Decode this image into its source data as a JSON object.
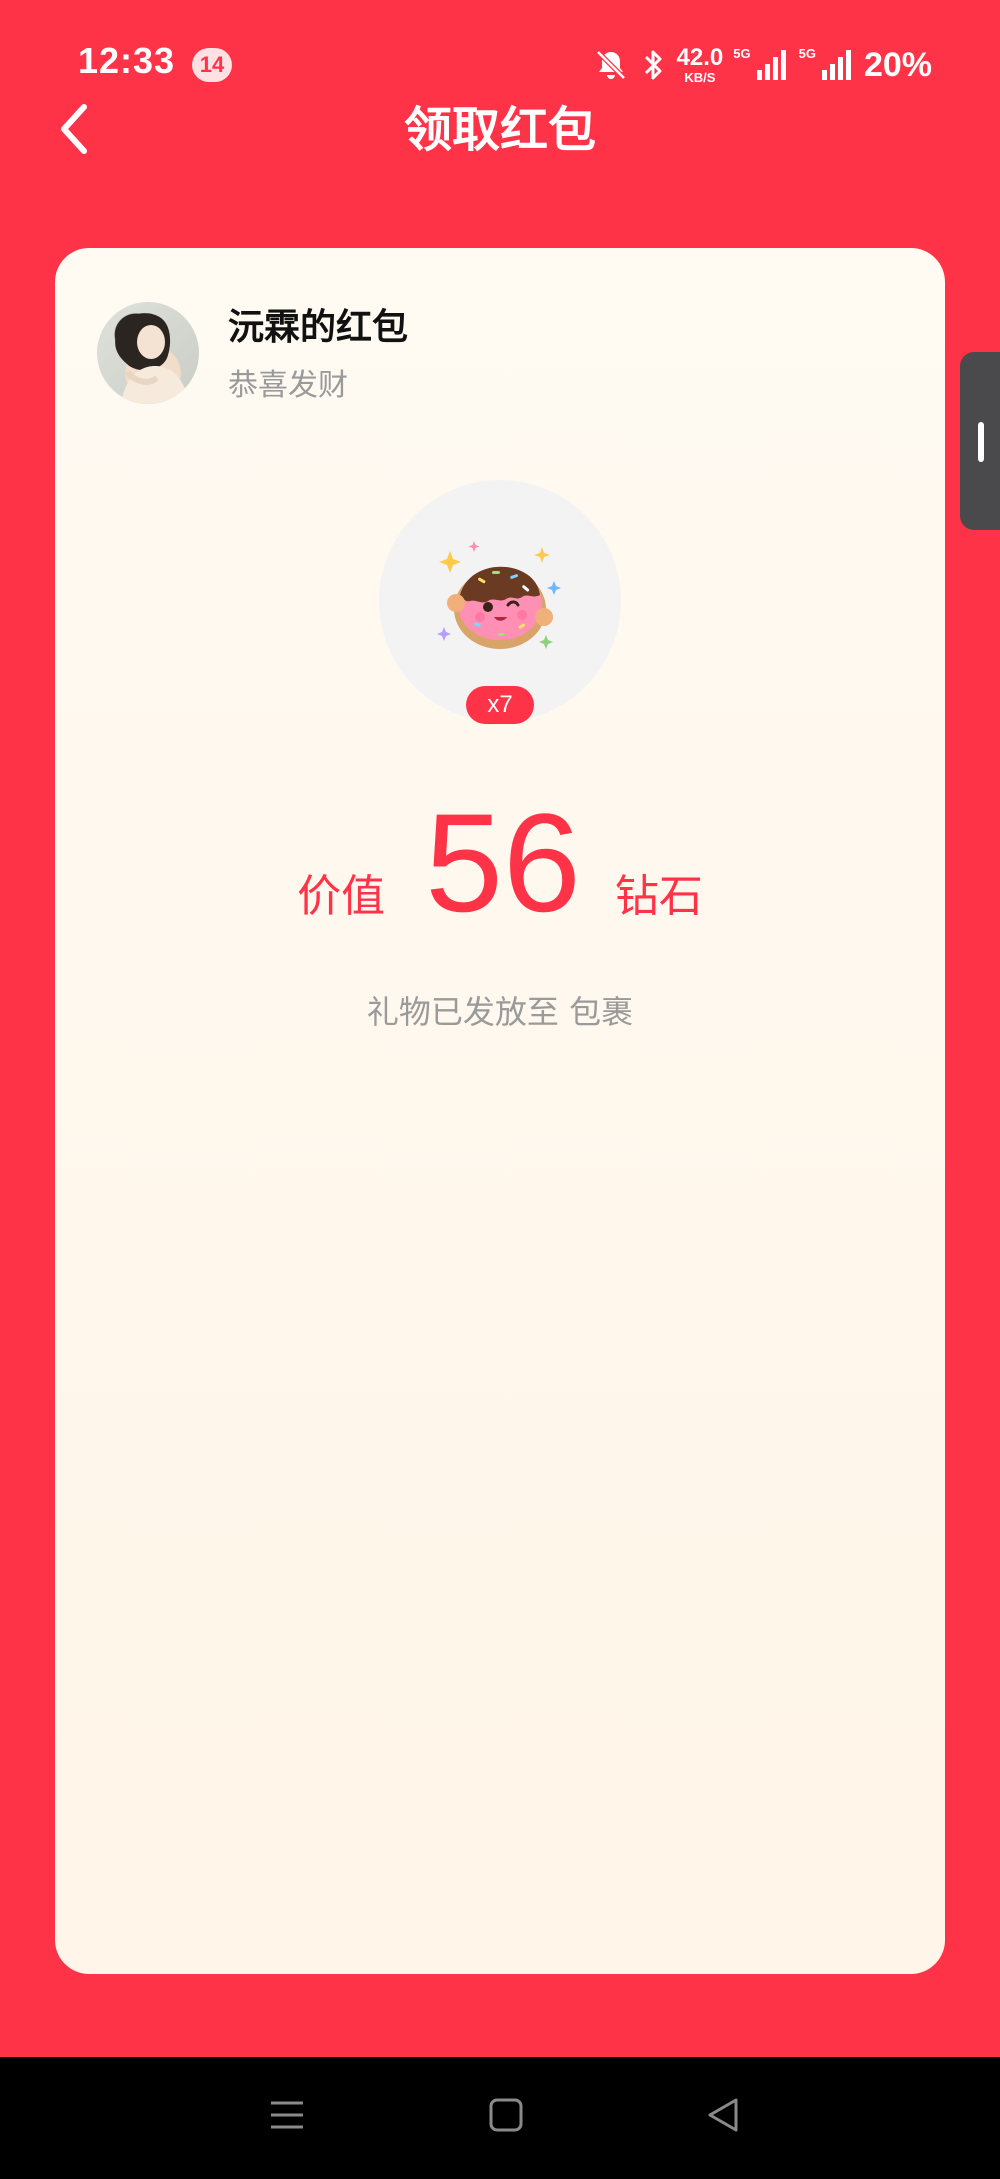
{
  "status_bar": {
    "time": "12:33",
    "notification_count": "14",
    "net_speed_value": "42.0",
    "net_speed_unit": "KB/S",
    "signal_label_1": "5G",
    "signal_label_2": "5G",
    "battery": "20%",
    "icons": [
      "mute-bell-icon",
      "bluetooth-icon",
      "signal-icon",
      "signal-icon"
    ]
  },
  "header": {
    "title": "领取红包",
    "back_icon": "chevron-left-icon"
  },
  "red_packet": {
    "sender_name": "沅霖的红包",
    "blessing": "恭喜发财",
    "gift_icon": "donut-icon",
    "quantity": "x7",
    "value_label": "价值",
    "value": "56",
    "value_unit": "钻石",
    "delivery_note": "礼物已发放至 包裹"
  },
  "nav_bar": {
    "icons": [
      "menu-icon",
      "home-icon",
      "back-triangle-icon"
    ]
  },
  "colors": {
    "background": "#ff3348",
    "card": "#fffaf2",
    "accent": "#ff3348",
    "muted_text": "#9a9a9a"
  }
}
